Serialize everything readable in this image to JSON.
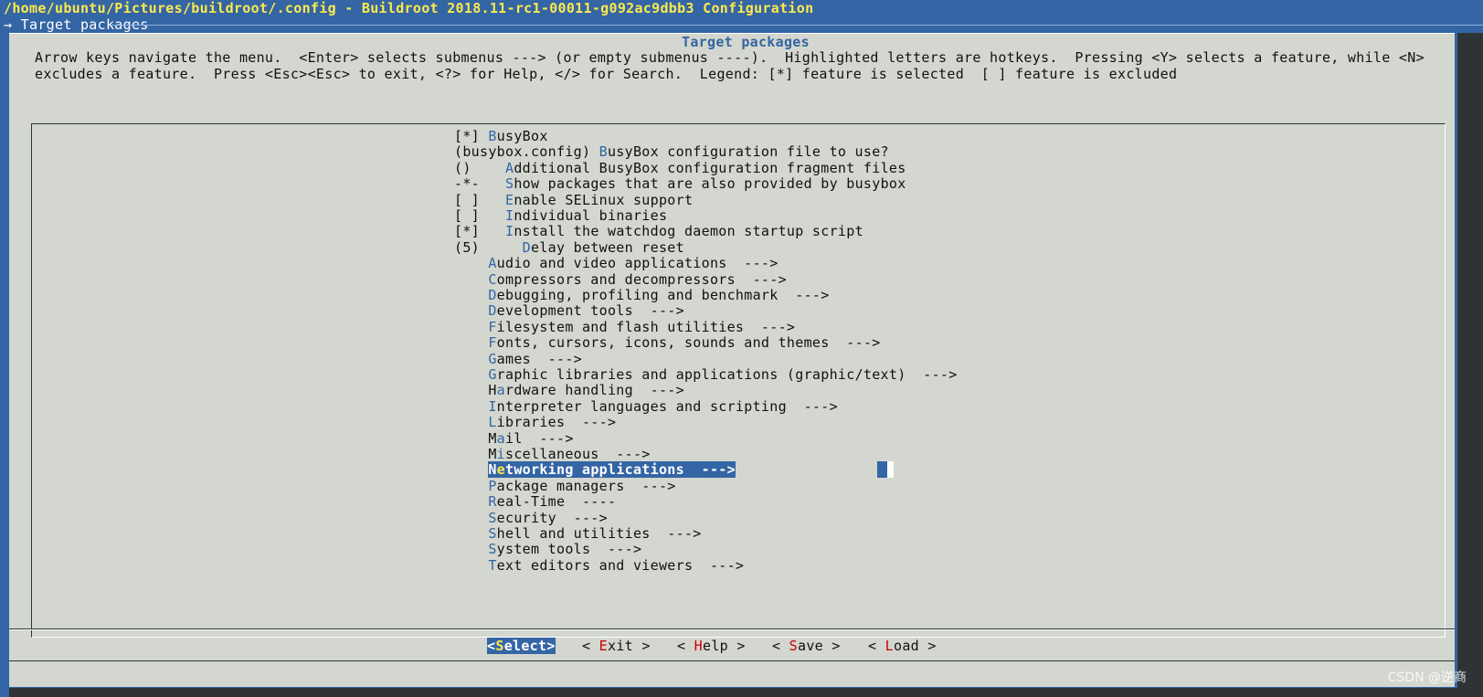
{
  "window": {
    "title": "/home/ubuntu/Pictures/buildroot/.config - Buildroot 2018.11-rc1-00011-g092ac9dbb3 Configuration",
    "backtitle": "→ Target packages"
  },
  "dialog": {
    "title": "Target packages",
    "help_lines": [
      "Arrow keys navigate the menu.  <Enter> selects submenus ---> (or empty submenus ----).  Highlighted letters are hotkeys.  Pressing <Y> selects a feature, while <N>",
      "excludes a feature.  Press <Esc><Esc> to exit, <?> for Help, </> for Search.  Legend: [*] feature is selected  [ ] feature is excluded"
    ]
  },
  "menu": {
    "items": [
      {
        "prefix": "[*] ",
        "hotkey": "B",
        "rest": "usyBox"
      },
      {
        "prefix": "(busybox.config) ",
        "hotkey": "B",
        "rest": "usyBox configuration file to use?"
      },
      {
        "prefix": "()    ",
        "hotkey": "A",
        "rest": "dditional BusyBox configuration fragment files"
      },
      {
        "prefix": "-*-   ",
        "hotkey": "S",
        "rest": "how packages that are also provided by busybox"
      },
      {
        "prefix": "[ ]   ",
        "hotkey": "E",
        "rest": "nable SELinux support"
      },
      {
        "prefix": "[ ]   ",
        "hotkey": "I",
        "rest": "ndividual binaries"
      },
      {
        "prefix": "[*]   ",
        "hotkey": "I",
        "rest": "nstall the watchdog daemon startup script"
      },
      {
        "prefix": "(5)     ",
        "hotkey": "D",
        "rest": "elay between reset"
      },
      {
        "prefix": "    ",
        "hotkey": "A",
        "rest": "udio and video applications  --->"
      },
      {
        "prefix": "    ",
        "hotkey": "C",
        "rest": "ompressors and decompressors  --->"
      },
      {
        "prefix": "    ",
        "hotkey": "D",
        "rest": "ebugging, profiling and benchmark  --->"
      },
      {
        "prefix": "    ",
        "hotkey": "D",
        "rest": "evelopment tools  --->"
      },
      {
        "prefix": "    ",
        "hotkey": "F",
        "rest": "ilesystem and flash utilities  --->"
      },
      {
        "prefix": "    ",
        "hotkey": "F",
        "rest": "onts, cursors, icons, sounds and themes  --->"
      },
      {
        "prefix": "    ",
        "hotkey": "G",
        "rest": "ames  --->"
      },
      {
        "prefix": "    ",
        "hotkey": "G",
        "rest": "raphic libraries and applications (graphic/text)  --->"
      },
      {
        "prefix": "    H",
        "hotkey": "a",
        "rest": "rdware handling  --->"
      },
      {
        "prefix": "    ",
        "hotkey": "I",
        "rest": "nterpreter languages and scripting  --->"
      },
      {
        "prefix": "    ",
        "hotkey": "L",
        "rest": "ibraries  --->"
      },
      {
        "prefix": "    M",
        "hotkey": "a",
        "rest": "il  --->"
      },
      {
        "prefix": "    M",
        "hotkey": "i",
        "rest": "scellaneous  --->"
      },
      {
        "prefix": "    N",
        "hotkey": "e",
        "rest": "tworking applications  --->",
        "selected": true
      },
      {
        "prefix": "    ",
        "hotkey": "P",
        "rest": "ackage managers  --->"
      },
      {
        "prefix": "    ",
        "hotkey": "R",
        "rest": "eal-Time  ----"
      },
      {
        "prefix": "    ",
        "hotkey": "S",
        "rest": "ecurity  --->"
      },
      {
        "prefix": "    ",
        "hotkey": "S",
        "rest": "hell and utilities  --->"
      },
      {
        "prefix": "    ",
        "hotkey": "S",
        "rest": "ystem tools  --->"
      },
      {
        "prefix": "    ",
        "hotkey": "T",
        "rest": "ext editors and viewers  --->"
      }
    ]
  },
  "buttons": [
    {
      "pre": "<",
      "hotkey": "S",
      "post": "elect>",
      "active": true
    },
    {
      "pre": "< ",
      "hotkey": "E",
      "post": "xit >",
      "active": false
    },
    {
      "pre": "< ",
      "hotkey": "H",
      "post": "elp >",
      "active": false
    },
    {
      "pre": "< ",
      "hotkey": "S",
      "post": "ave >",
      "active": false
    },
    {
      "pre": "< ",
      "hotkey": "L",
      "post": "oad >",
      "active": false
    }
  ],
  "watermark": "CSDN @逆商"
}
